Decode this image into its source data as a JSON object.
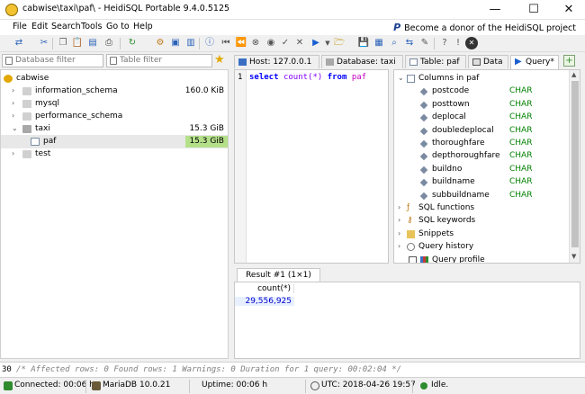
{
  "window": {
    "title": "cabwise\\taxi\\paf\\ - HeidiSQL Portable 9.4.0.5125",
    "minimize": "—",
    "maximize": "☐",
    "close": "✕"
  },
  "menu": {
    "items": [
      "File",
      "Edit",
      "Search",
      "Tools",
      "Go to",
      "Help"
    ],
    "donor": "Become a donor of the HeidiSQL project",
    "donor_logo": "P"
  },
  "filters": {
    "database_placeholder": "Database filter",
    "table_placeholder": "Table filter"
  },
  "tree": {
    "root": "cabwise",
    "items": [
      {
        "label": "information_schema",
        "size": "160.0 KiB"
      },
      {
        "label": "mysql",
        "size": ""
      },
      {
        "label": "performance_schema",
        "size": ""
      },
      {
        "label": "taxi",
        "size": "15.3 GiB"
      },
      {
        "label": "paf",
        "size": "15.3 GiB"
      },
      {
        "label": "test",
        "size": ""
      }
    ]
  },
  "tabs": [
    {
      "label": "Host: 127.0.0.1"
    },
    {
      "label": "Database: taxi"
    },
    {
      "label": "Table: paf"
    },
    {
      "label": "Data"
    },
    {
      "label": "Query*"
    }
  ],
  "editor": {
    "line_number": "1",
    "kw_select": "select",
    "fn_count": "count(*)",
    "kw_from": "from",
    "table": "paf"
  },
  "help": {
    "columns_header": "Columns in paf",
    "columns": [
      {
        "name": "postcode",
        "type": "CHAR"
      },
      {
        "name": "posttown",
        "type": "CHAR"
      },
      {
        "name": "deplocal",
        "type": "CHAR"
      },
      {
        "name": "doubledeplocal",
        "type": "CHAR"
      },
      {
        "name": "thoroughfare",
        "type": "CHAR"
      },
      {
        "name": "depthoroughfare",
        "type": "CHAR"
      },
      {
        "name": "buildno",
        "type": "CHAR"
      },
      {
        "name": "buildname",
        "type": "CHAR"
      },
      {
        "name": "subbuildname",
        "type": "CHAR"
      }
    ],
    "sections": [
      "SQL functions",
      "SQL keywords",
      "Snippets",
      "Query history",
      "Query profile"
    ]
  },
  "result": {
    "tab_label": "Result #1 (1×1)",
    "column": "count(*)",
    "value": "29,556,925"
  },
  "log": {
    "line": "30",
    "text": "/* Affected rows: 0  Found rows: 1  Warnings: 0  Duration for 1 query: 00:02:04 */"
  },
  "status": {
    "connected": "Connected: 00:06 h",
    "server": "MariaDB 10.0.21",
    "uptime": "Uptime: 00:06 h",
    "utc": "UTC: 2018-04-26 19:57",
    "state": "Idle."
  },
  "colors": {
    "keyword": "#0000ff",
    "function": "#8000ff",
    "table_name": "#c000c0",
    "type_text": "#008000",
    "selected_size": "#b5e08a"
  }
}
